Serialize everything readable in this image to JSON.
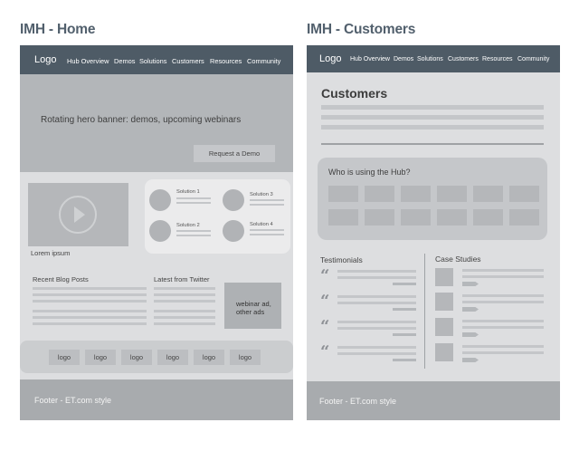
{
  "home": {
    "title": "IMH - Home",
    "logo": "Logo",
    "nav": [
      "Hub Overview",
      "Demos",
      "Solutions",
      "Customers",
      "Resources",
      "Community"
    ],
    "hero_text": "Rotating hero banner: demos, upcoming webinars",
    "hero_button": "Request a Demo",
    "video_caption": "Lorem ipsum",
    "solutions": [
      "Solution 1",
      "Solution 3",
      "Solution 2",
      "Solution 4"
    ],
    "blog_heading": "Recent Blog Posts",
    "twitter_heading": "Latest from Twitter",
    "ad_text_1": "webinar ad,",
    "ad_text_2": "other ads",
    "logos": [
      "logo",
      "logo",
      "logo",
      "logo",
      "logo",
      "logo"
    ],
    "footer": "Footer - ET.com style"
  },
  "customers": {
    "title": "IMH - Customers",
    "logo": "Logo",
    "nav": [
      "Hub Overview",
      "Demos",
      "Solutions",
      "Customers",
      "Resources",
      "Community"
    ],
    "heading": "Customers",
    "hub_box_title": "Who is using the Hub?",
    "testimonials_heading": "Testimonials",
    "case_studies_heading": "Case Studies",
    "footer": "Footer - ET.com style"
  }
}
